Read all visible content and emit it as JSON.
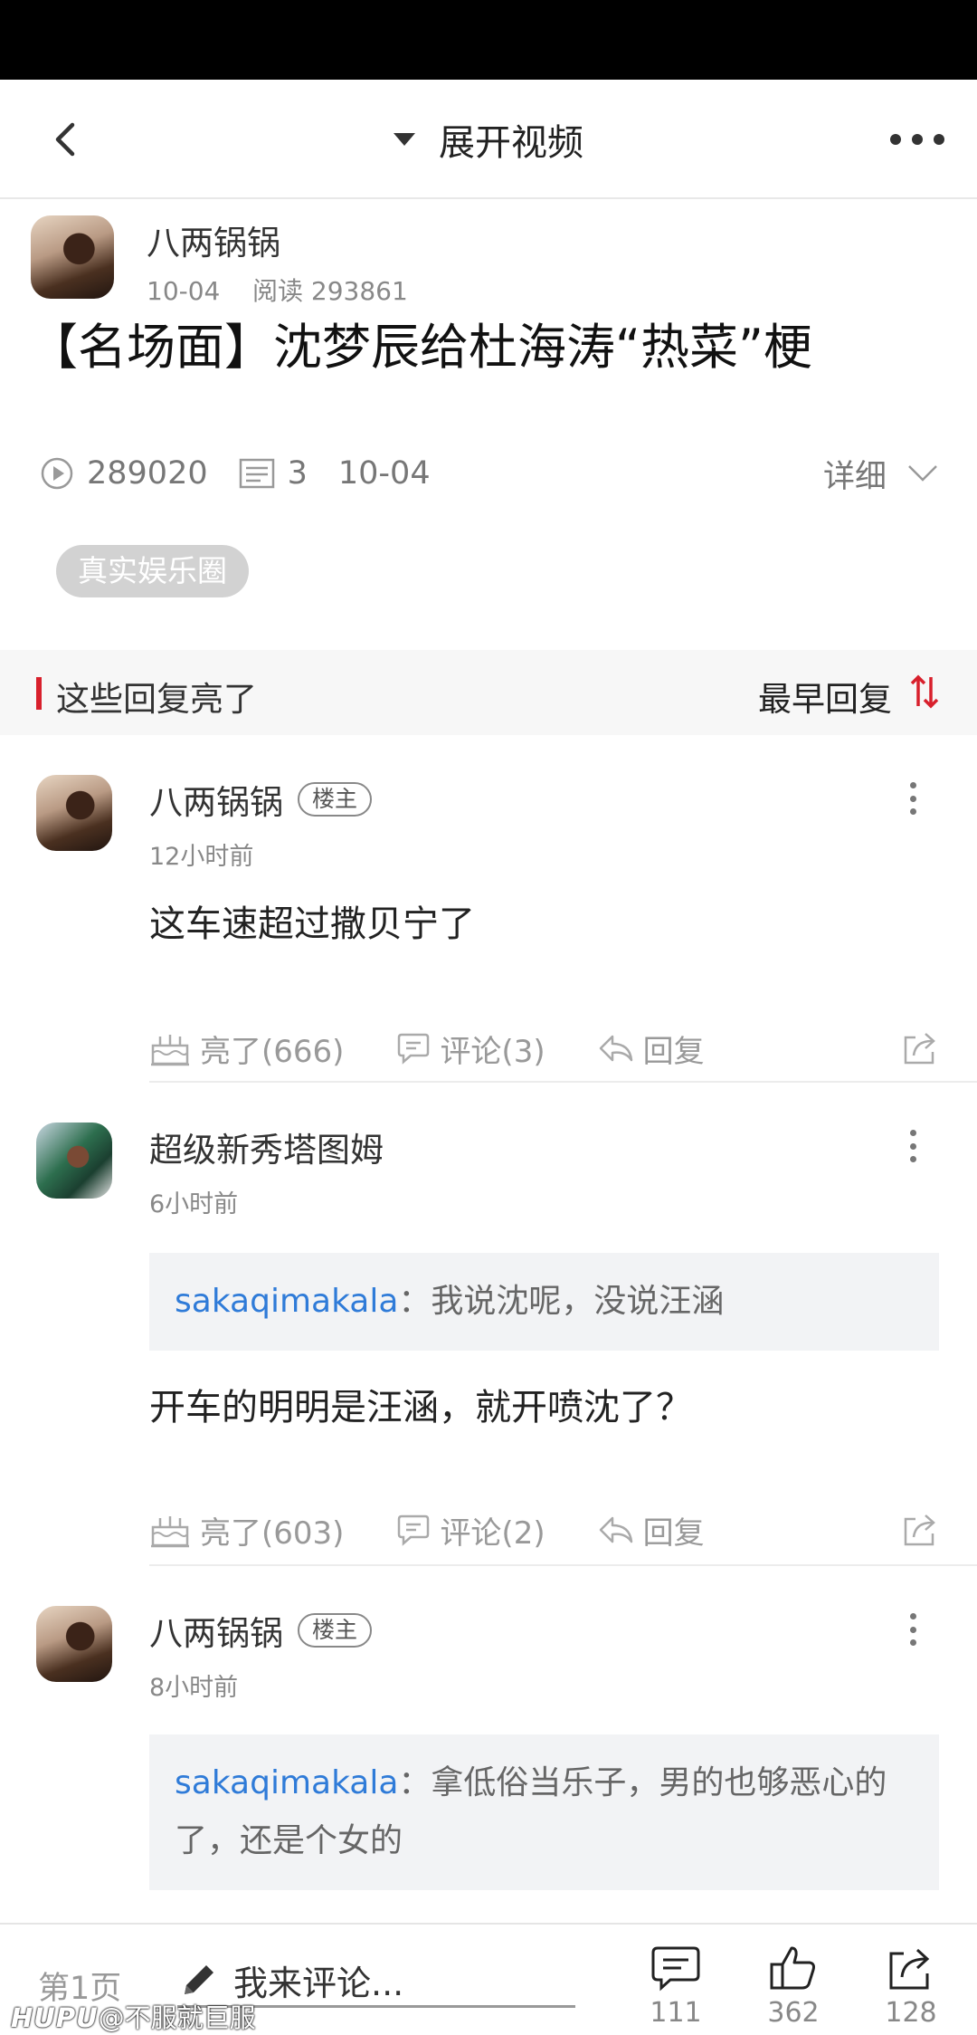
{
  "nav": {
    "title": "展开视频"
  },
  "post": {
    "author": "八两锅锅",
    "date": "10-04",
    "views_label": "阅读 293861",
    "title": "【名场面】沈梦辰给杜海涛“热菜”梗",
    "stats": {
      "plays": "289020",
      "comments": "3",
      "date": "10-04"
    },
    "detail_label": "详细",
    "tag": "真实娱乐圈"
  },
  "section": {
    "title": "这些回复亮了",
    "sort_label": "最早回复"
  },
  "replies": [
    {
      "author": "八两锅锅",
      "badge": "楼主",
      "time": "12小时前",
      "text": "这车速超过撒贝宁了",
      "actions": {
        "light": "亮了(666)",
        "comment": "评论(3)",
        "reply": "回复"
      }
    },
    {
      "author": "超级新秀塔图姆",
      "time": "6小时前",
      "quote_user": "sakaqimakala",
      "quote_text": "：我说沈呢，没说汪涵",
      "text": "开车的明明是汪涵，就开喷沈了？",
      "actions": {
        "light": "亮了(603)",
        "comment": "评论(2)",
        "reply": "回复"
      }
    },
    {
      "author": "八两锅锅",
      "badge": "楼主",
      "time": "8小时前",
      "quote_user": "sakaqimakala",
      "quote_text_line1": "：拿低俗当乐子，男的也够恶心的",
      "quote_text_line2": "了，还是个女的"
    }
  ],
  "bottom": {
    "page": "第1页",
    "compose_placeholder": "我来评论...",
    "comments_count": "111",
    "likes_count": "362",
    "shares_count": "128"
  },
  "watermark": {
    "brand": "HUPU",
    "handle": "@不服就巨服"
  },
  "colors": {
    "accent_red": "#d8202c",
    "link_blue": "#2f7bd8"
  }
}
